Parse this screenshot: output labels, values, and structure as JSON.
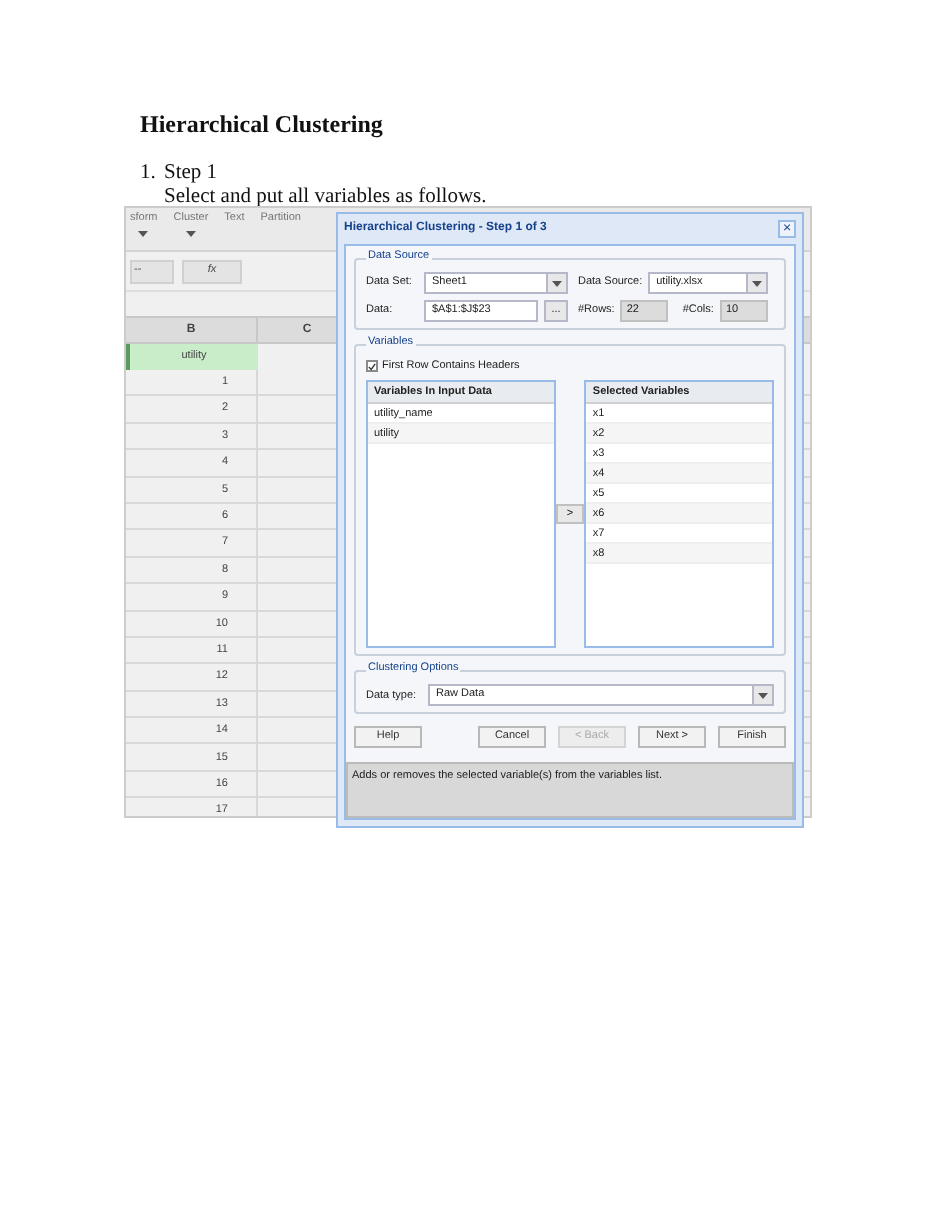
{
  "heading": "Hierarchical Clustering",
  "step": {
    "number": "1.",
    "title": "Step 1",
    "text": "Select and put all variables as follows."
  },
  "spreadsheet": {
    "ribbon": [
      {
        "label": "sform",
        "dropdown": true
      },
      {
        "label": "Cluster",
        "dropdown": true
      },
      {
        "label": "Text",
        "dropdown": false
      },
      {
        "label": "Partition",
        "dropdown": false
      }
    ],
    "formula_bar": {
      "name_box": "--",
      "fx": "fx"
    },
    "columns": [
      "B",
      "C"
    ],
    "header_row": "utility",
    "rows": [
      "1",
      "2",
      "3",
      "4",
      "5",
      "6",
      "7",
      "8",
      "9",
      "10",
      "11",
      "12",
      "13",
      "14",
      "15",
      "16",
      "17"
    ]
  },
  "dialog": {
    "title": "Hierarchical Clustering - Step 1 of 3",
    "close": "×",
    "data_source": {
      "legend": "Data Source",
      "data_set_label": "Data Set:",
      "data_set": "Sheet1",
      "source_label": "Data Source:",
      "source": "utility.xlsx",
      "data_label": "Data:",
      "data": "$A$1:$J$23",
      "browse": "...",
      "rows_label": "#Rows:",
      "rows": "22",
      "cols_label": "#Cols:",
      "cols": "10"
    },
    "variables": {
      "legend": "Variables",
      "first_row_headers": {
        "label": "First Row Contains Headers",
        "checked": true
      },
      "input_header": "Variables In Input Data",
      "input": [
        "utility_name",
        "utility"
      ],
      "move": ">",
      "selected_header": "Selected Variables",
      "selected": [
        "x1",
        "x2",
        "x3",
        "x4",
        "x5",
        "x6",
        "x7",
        "x8"
      ]
    },
    "clustering": {
      "legend": "Clustering Options",
      "label": "Data type:",
      "value": "Raw Data"
    },
    "buttons": [
      {
        "label": "Help",
        "disabled": false
      },
      {
        "label": "Cancel",
        "disabled": false
      },
      {
        "label": "< Back",
        "disabled": true
      },
      {
        "label": "Next >",
        "disabled": false
      },
      {
        "label": "Finish",
        "disabled": false
      }
    ],
    "status": "Adds or removes the selected variable(s) from the variables list."
  }
}
